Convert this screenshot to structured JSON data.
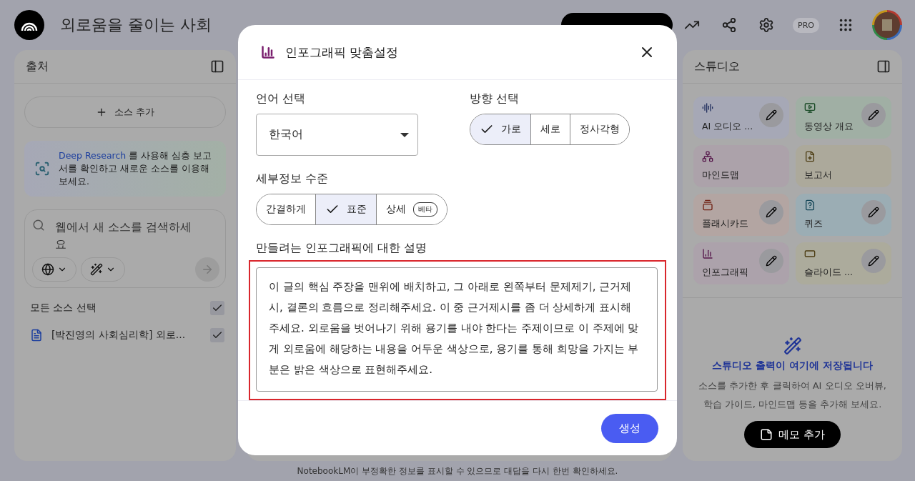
{
  "header": {
    "title": "외로움을 줄이는 사회",
    "plan_badge": "PRO"
  },
  "sources_panel": {
    "title": "출처",
    "add_button": "소스 추가",
    "promo": {
      "link": "Deep Research",
      "text": " 를 사용해 심층 보고서를 확인하고 새로운 소스를 이용해 보세요."
    },
    "search": {
      "placeholder": "웹에서 새 소스를 검색하세요"
    },
    "select_all": {
      "label": "모든 소스 선택",
      "checked": true
    },
    "sources": [
      {
        "title": "[박진영의 사회심리학] 외로...",
        "checked": true
      }
    ]
  },
  "studio_panel": {
    "title": "스튜디오",
    "tools": [
      {
        "kind": "audio",
        "label": "AI 오디오 ...",
        "color": "#a6a8b6",
        "editable": true
      },
      {
        "kind": "video",
        "label": "동영상 개요",
        "color": "#a0afa4",
        "editable": true
      },
      {
        "kind": "mindmap",
        "label": "마인드맵",
        "color": "#aca2aa",
        "editable": false
      },
      {
        "kind": "report",
        "label": "보고서",
        "color": "#aca99b",
        "editable": false
      },
      {
        "kind": "flashcards",
        "label": "플래시카드",
        "color": "#b3a5a2",
        "editable": true
      },
      {
        "kind": "quiz",
        "label": "퀴즈",
        "color": "#9badb4",
        "editable": true
      },
      {
        "kind": "infographic",
        "label": "인포그래픽",
        "color": "#aca2ab",
        "editable": true
      },
      {
        "kind": "slides",
        "label": "슬라이드 ...",
        "color": "#acab9c",
        "editable": true
      }
    ],
    "empty_title": "스튜디오 출력이 여기에 저장됩니다",
    "empty_text": "소스를 추가한 후 클릭하여 AI 오디오 오버뷰, 학습 가이드, 마인드맵 등을 추가해 보세요.",
    "note_button": "메모 추가"
  },
  "footer": "NotebookLM이 부정확한 정보를 표시할 수 있으므로 대답을 다시 한번 확인하세요.",
  "dialog": {
    "title": "인포그래픽 맞춤설정",
    "language": {
      "label": "언어 선택",
      "value": "한국어"
    },
    "orientation": {
      "label": "방향 선택",
      "options": [
        {
          "label": "가로",
          "selected": true
        },
        {
          "label": "세로",
          "selected": false
        },
        {
          "label": "정사각형",
          "selected": false
        }
      ]
    },
    "detail": {
      "label": "세부정보 수준",
      "options": [
        {
          "label": "간결하게",
          "selected": false
        },
        {
          "label": "표준",
          "selected": true
        },
        {
          "label": "상세",
          "selected": false,
          "badge": "베타"
        }
      ]
    },
    "description": {
      "label": "만들려는 인포그래픽에 대한 설명",
      "value": "이 글의 핵심 주장을 맨위에 배치하고, 그 아래로 왼쪽부터 문제제기, 근거제시, 결론의 흐름으로 정리해주세요. 이 중 근거제시를 좀 더 상세하게 표시해주세요. 외로움을 벗어나기 위해 용기를 내야 한다는 주제이므로 이 주제에 맞게 외로움에 해당하는 내용을 어두운 색상으로, 용기를 통해 희망을 가지는 부분은 밝은 색상으로 표현해주세요."
    },
    "generate_button": "생성"
  }
}
